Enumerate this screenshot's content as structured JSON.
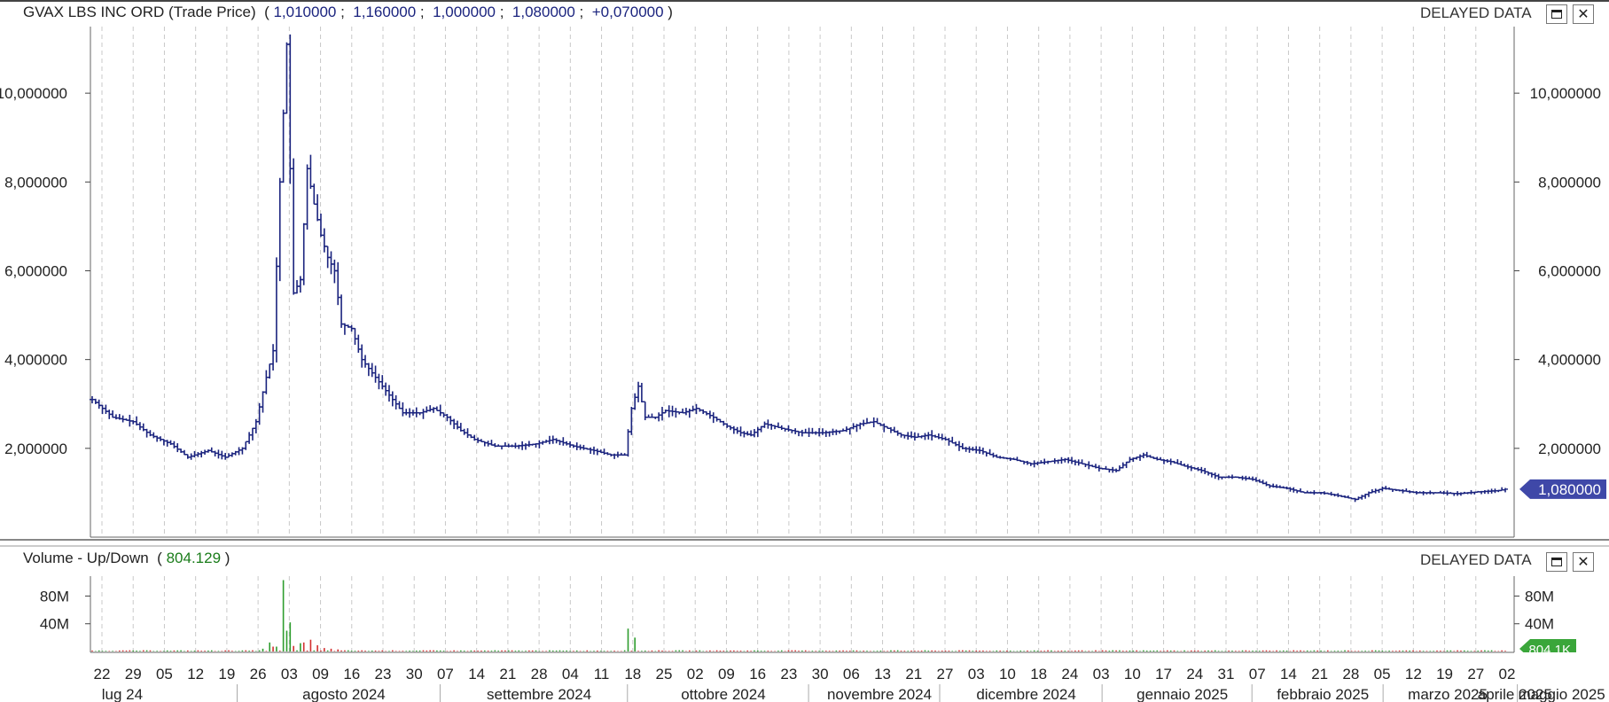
{
  "price_panel": {
    "title": "GVAX LBS INC ORD (Trade Price)",
    "open": "1,010000",
    "high": "1,160000",
    "low": "1,000000",
    "close": "1,080000",
    "change": "+0,070000",
    "delayed_label": "DELAYED DATA",
    "last_price_label": "1,080000"
  },
  "volume_panel": {
    "title": "Volume - Up/Down",
    "value": "804.129",
    "delayed_label": "DELAYED DATA",
    "last_volume_label": "804.1K"
  },
  "colors": {
    "price_bars": "#1a237e",
    "volume_up": "#2e9d2e",
    "volume_down": "#d32f2f",
    "last_price_tag": "#3f48a8",
    "last_volume_tag": "#3aa63a"
  },
  "chart_data": [
    {
      "type": "ohlc",
      "title": "GVAX LBS INC ORD (Trade Price)",
      "y_ticks": [
        "2,000000",
        "4,000000",
        "6,000000",
        "8,000000",
        "10,000000"
      ],
      "ylim": [
        0,
        11.5
      ],
      "grid": "vertical dashed",
      "x_day_labels": [
        "22",
        "29",
        "05",
        "12",
        "19",
        "26",
        "03",
        "09",
        "16",
        "23",
        "30",
        "07",
        "14",
        "21",
        "28",
        "04",
        "11",
        "18",
        "25",
        "02",
        "09",
        "16",
        "23",
        "30",
        "06",
        "13",
        "21",
        "27",
        "03",
        "10",
        "18",
        "24",
        "03",
        "10",
        "17",
        "24",
        "31",
        "07",
        "14",
        "21",
        "28",
        "05",
        "12",
        "19",
        "27",
        "02"
      ],
      "x_month_labels": [
        "lug 24",
        "agosto 2024",
        "settembre 2024",
        "ottobre 2024",
        "novembre 2024",
        "dicembre 2024",
        "gennaio 2025",
        "febbraio 2025",
        "marzo 2025",
        "aprile 2025",
        "maggio 2025"
      ],
      "key_points": [
        [
          0,
          3.1
        ],
        [
          6,
          2.7
        ],
        [
          12,
          2.6
        ],
        [
          17,
          2.3
        ],
        [
          23,
          2.1
        ],
        [
          28,
          1.8
        ],
        [
          34,
          1.95
        ],
        [
          39,
          1.8
        ],
        [
          44,
          2.0
        ],
        [
          48,
          2.6
        ],
        [
          51,
          3.6
        ],
        [
          53,
          4.2
        ],
        [
          55,
          8.0
        ],
        [
          57,
          11.1
        ],
        [
          59,
          5.5
        ],
        [
          61,
          5.8
        ],
        [
          63,
          8.3
        ],
        [
          65,
          7.5
        ],
        [
          67,
          6.8
        ],
        [
          69,
          6.3
        ],
        [
          71,
          6.0
        ],
        [
          73,
          4.8
        ],
        [
          76,
          4.7
        ],
        [
          79,
          4.0
        ],
        [
          82,
          3.7
        ],
        [
          85,
          3.4
        ],
        [
          88,
          3.1
        ],
        [
          91,
          2.8
        ],
        [
          96,
          2.8
        ],
        [
          100,
          2.9
        ],
        [
          104,
          2.7
        ],
        [
          108,
          2.4
        ],
        [
          112,
          2.2
        ],
        [
          118,
          2.05
        ],
        [
          124,
          2.05
        ],
        [
          130,
          2.1
        ],
        [
          135,
          2.2
        ],
        [
          141,
          2.05
        ],
        [
          147,
          1.95
        ],
        [
          152,
          1.85
        ],
        [
          156,
          1.85
        ],
        [
          158,
          2.9
        ],
        [
          160,
          3.4
        ],
        [
          162,
          2.7
        ],
        [
          165,
          2.7
        ],
        [
          168,
          2.85
        ],
        [
          173,
          2.8
        ],
        [
          177,
          2.9
        ],
        [
          182,
          2.7
        ],
        [
          186,
          2.5
        ],
        [
          190,
          2.35
        ],
        [
          193,
          2.3
        ],
        [
          197,
          2.55
        ],
        [
          202,
          2.45
        ],
        [
          208,
          2.35
        ],
        [
          214,
          2.35
        ],
        [
          220,
          2.4
        ],
        [
          225,
          2.55
        ],
        [
          229,
          2.6
        ],
        [
          233,
          2.45
        ],
        [
          237,
          2.3
        ],
        [
          241,
          2.25
        ],
        [
          245,
          2.3
        ],
        [
          250,
          2.2
        ],
        [
          255,
          2.0
        ],
        [
          260,
          1.95
        ],
        [
          265,
          1.8
        ],
        [
          270,
          1.75
        ],
        [
          275,
          1.65
        ],
        [
          280,
          1.7
        ],
        [
          285,
          1.75
        ],
        [
          290,
          1.65
        ],
        [
          295,
          1.55
        ],
        [
          300,
          1.5
        ],
        [
          304,
          1.75
        ],
        [
          308,
          1.85
        ],
        [
          312,
          1.75
        ],
        [
          316,
          1.7
        ],
        [
          320,
          1.6
        ],
        [
          325,
          1.5
        ],
        [
          330,
          1.35
        ],
        [
          335,
          1.35
        ],
        [
          340,
          1.3
        ],
        [
          345,
          1.15
        ],
        [
          350,
          1.1
        ],
        [
          355,
          1.0
        ],
        [
          360,
          1.0
        ],
        [
          364,
          0.95
        ],
        [
          367,
          0.9
        ],
        [
          370,
          0.85
        ],
        [
          374,
          1.0
        ],
        [
          378,
          1.1
        ],
        [
          383,
          1.05
        ],
        [
          388,
          1.0
        ],
        [
          394,
          1.0
        ],
        [
          400,
          0.98
        ],
        [
          406,
          1.02
        ],
        [
          412,
          1.05
        ],
        [
          414,
          1.08
        ]
      ]
    },
    {
      "type": "bar",
      "title": "Volume - Up/Down",
      "y_ticks": [
        "40M",
        "80M"
      ],
      "ylim": [
        0,
        110
      ],
      "unit": "M",
      "spikes": [
        {
          "i": 50,
          "v": 4,
          "up": true
        },
        {
          "i": 52,
          "v": 13,
          "up": true
        },
        {
          "i": 53,
          "v": 7,
          "up": false
        },
        {
          "i": 54,
          "v": 7,
          "up": true
        },
        {
          "i": 56,
          "v": 103,
          "up": true
        },
        {
          "i": 57,
          "v": 30,
          "up": true
        },
        {
          "i": 58,
          "v": 42,
          "up": true
        },
        {
          "i": 59,
          "v": 8,
          "up": false
        },
        {
          "i": 61,
          "v": 12,
          "up": true
        },
        {
          "i": 62,
          "v": 13,
          "up": false
        },
        {
          "i": 64,
          "v": 17,
          "up": false
        },
        {
          "i": 66,
          "v": 9,
          "up": false
        },
        {
          "i": 68,
          "v": 5,
          "up": false
        },
        {
          "i": 70,
          "v": 4,
          "up": false
        },
        {
          "i": 72,
          "v": 3,
          "up": false
        },
        {
          "i": 157,
          "v": 33,
          "up": true
        },
        {
          "i": 159,
          "v": 20,
          "up": true
        }
      ]
    }
  ]
}
